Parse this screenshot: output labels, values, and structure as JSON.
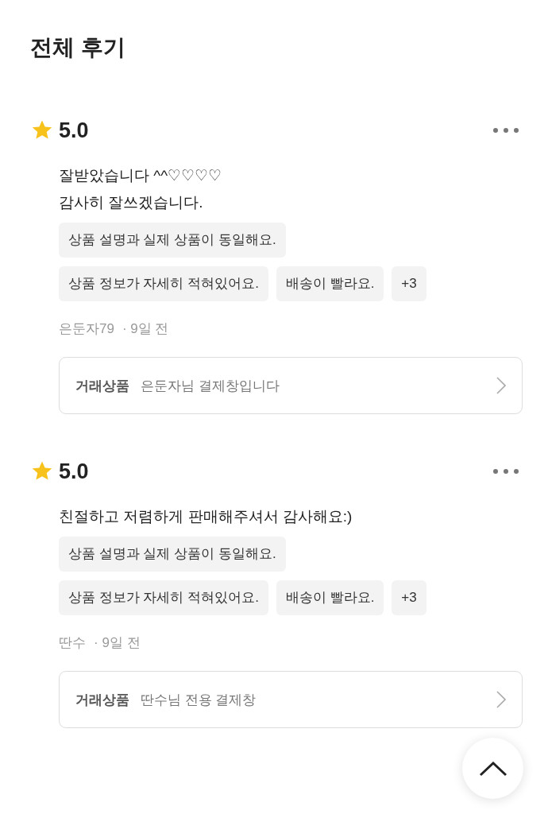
{
  "title": "전체 후기",
  "reviews": [
    {
      "rating": "5.0",
      "text": "잘받았습니다 ^^♡♡♡♡\n감사히 잘쓰겠습니다.",
      "tags": [
        "상품 설명과 실제 상품이 동일해요.",
        "상품 정보가 자세히 적혀있어요.",
        "배송이 빨라요.",
        "+3"
      ],
      "author": "은둔자79",
      "time": "· 9일 전",
      "product_label": "거래상품",
      "product_name": "은둔자님 결제창입니다"
    },
    {
      "rating": "5.0",
      "text": "친절하고 저렴하게 판매해주셔서 감사해요:)",
      "tags": [
        "상품 설명과 실제 상품이 동일해요.",
        "상품 정보가 자세히 적혀있어요.",
        "배송이 빨라요.",
        "+3"
      ],
      "author": "딴수",
      "time": "· 9일 전",
      "product_label": "거래상품",
      "product_name": "딴수님 전용 결제창"
    }
  ]
}
